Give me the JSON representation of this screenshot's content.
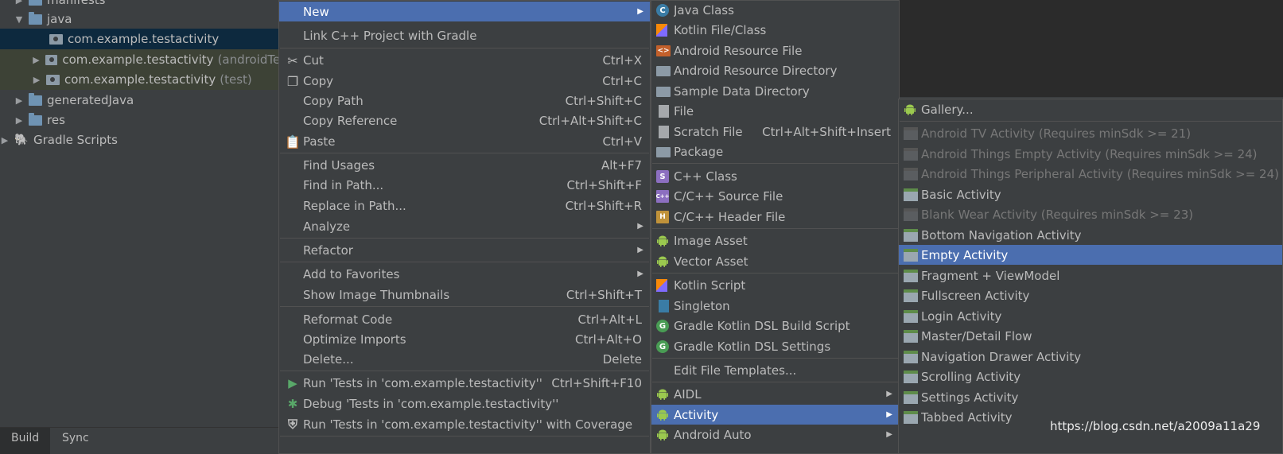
{
  "tree": {
    "rows": [
      {
        "label": "manifests",
        "suffix": ""
      },
      {
        "label": "java",
        "suffix": ""
      },
      {
        "label": "com.example.testactivity",
        "suffix": ""
      },
      {
        "label": "com.example.testactivity",
        "suffix": "(androidTes"
      },
      {
        "label": "com.example.testactivity",
        "suffix": "(test)"
      },
      {
        "label": "generatedJava",
        "suffix": ""
      },
      {
        "label": "res",
        "suffix": ""
      },
      {
        "label": "Gradle Scripts",
        "suffix": ""
      }
    ]
  },
  "bottom_tabs": [
    "Build",
    "Sync"
  ],
  "menu_main": {
    "items": [
      {
        "label": "New",
        "shortcut": ""
      },
      {
        "label": "Link C++ Project with Gradle",
        "shortcut": ""
      },
      {
        "label": "Cut",
        "shortcut": "Ctrl+X"
      },
      {
        "label": "Copy",
        "shortcut": "Ctrl+C"
      },
      {
        "label": "Copy Path",
        "shortcut": "Ctrl+Shift+C"
      },
      {
        "label": "Copy Reference",
        "shortcut": "Ctrl+Alt+Shift+C"
      },
      {
        "label": "Paste",
        "shortcut": "Ctrl+V"
      },
      {
        "label": "Find Usages",
        "shortcut": "Alt+F7"
      },
      {
        "label": "Find in Path...",
        "shortcut": "Ctrl+Shift+F"
      },
      {
        "label": "Replace in Path...",
        "shortcut": "Ctrl+Shift+R"
      },
      {
        "label": "Analyze",
        "shortcut": ""
      },
      {
        "label": "Refactor",
        "shortcut": ""
      },
      {
        "label": "Add to Favorites",
        "shortcut": ""
      },
      {
        "label": "Show Image Thumbnails",
        "shortcut": "Ctrl+Shift+T"
      },
      {
        "label": "Reformat Code",
        "shortcut": "Ctrl+Alt+L"
      },
      {
        "label": "Optimize Imports",
        "shortcut": "Ctrl+Alt+O"
      },
      {
        "label": "Delete...",
        "shortcut": "Delete"
      },
      {
        "label": "Run 'Tests in 'com.example.testactivity''",
        "shortcut": "Ctrl+Shift+F10"
      },
      {
        "label": "Debug 'Tests in 'com.example.testactivity''",
        "shortcut": ""
      },
      {
        "label": "Run 'Tests in 'com.example.testactivity'' with Coverage",
        "shortcut": ""
      }
    ]
  },
  "menu_new": {
    "items": [
      {
        "label": "Java Class",
        "shortcut": ""
      },
      {
        "label": "Kotlin File/Class",
        "shortcut": ""
      },
      {
        "label": "Android Resource File",
        "shortcut": ""
      },
      {
        "label": "Android Resource Directory",
        "shortcut": ""
      },
      {
        "label": "Sample Data Directory",
        "shortcut": ""
      },
      {
        "label": "File",
        "shortcut": ""
      },
      {
        "label": "Scratch File",
        "shortcut": "Ctrl+Alt+Shift+Insert"
      },
      {
        "label": "Package",
        "shortcut": ""
      },
      {
        "label": "C++ Class",
        "shortcut": ""
      },
      {
        "label": "C/C++ Source File",
        "shortcut": ""
      },
      {
        "label": "C/C++ Header File",
        "shortcut": ""
      },
      {
        "label": "Image Asset",
        "shortcut": ""
      },
      {
        "label": "Vector Asset",
        "shortcut": ""
      },
      {
        "label": "Kotlin Script",
        "shortcut": ""
      },
      {
        "label": "Singleton",
        "shortcut": ""
      },
      {
        "label": "Gradle Kotlin DSL Build Script",
        "shortcut": ""
      },
      {
        "label": "Gradle Kotlin DSL Settings",
        "shortcut": ""
      },
      {
        "label": "Edit File Templates...",
        "shortcut": ""
      },
      {
        "label": "AIDL",
        "shortcut": ""
      },
      {
        "label": "Activity",
        "shortcut": ""
      },
      {
        "label": "Android Auto",
        "shortcut": ""
      }
    ]
  },
  "menu_activity": {
    "items": [
      {
        "label": "Gallery..."
      },
      {
        "label": "Android TV Activity (Requires minSdk >= 21)"
      },
      {
        "label": "Android Things Empty Activity (Requires minSdk >= 24)"
      },
      {
        "label": "Android Things Peripheral Activity (Requires minSdk >= 24)"
      },
      {
        "label": "Basic Activity"
      },
      {
        "label": "Blank Wear Activity (Requires minSdk >= 23)"
      },
      {
        "label": "Bottom Navigation Activity"
      },
      {
        "label": "Empty Activity"
      },
      {
        "label": "Fragment + ViewModel"
      },
      {
        "label": "Fullscreen Activity"
      },
      {
        "label": "Login Activity"
      },
      {
        "label": "Master/Detail Flow"
      },
      {
        "label": "Navigation Drawer Activity"
      },
      {
        "label": "Scrolling Activity"
      },
      {
        "label": "Settings Activity"
      },
      {
        "label": "Tabbed Activity"
      }
    ]
  },
  "watermark": "https://blog.csdn.net/a2009a11a29",
  "colors": {
    "highlight": "#4b6eaf",
    "background": "#3c3f41",
    "editor": "#2b2b2b"
  }
}
